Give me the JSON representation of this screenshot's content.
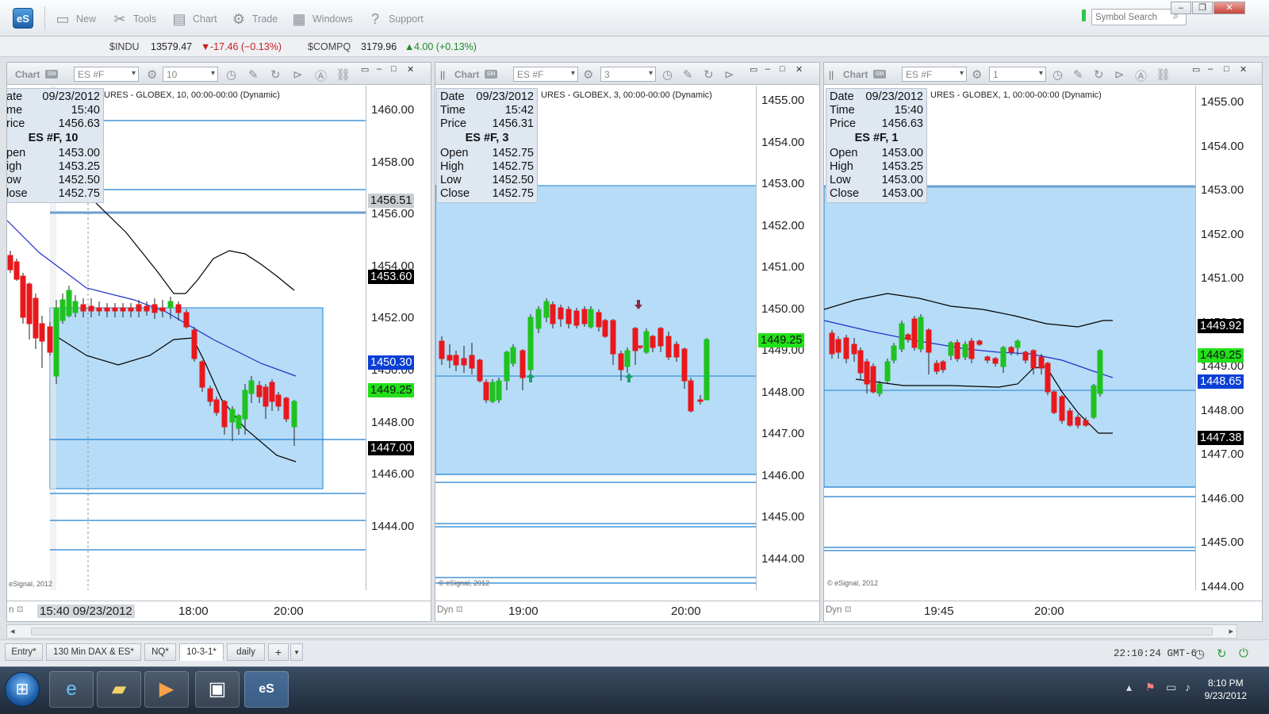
{
  "app": {
    "logo": "eS"
  },
  "toolbar": {
    "items": [
      {
        "label": "New",
        "icon": "new-window-icon"
      },
      {
        "label": "Tools",
        "icon": "tools-icon"
      },
      {
        "label": "Chart",
        "icon": "chart-icon"
      },
      {
        "label": "Trade",
        "icon": "trade-icon"
      },
      {
        "label": "Windows",
        "icon": "windows-icon"
      },
      {
        "label": "Support",
        "icon": "support-icon"
      }
    ],
    "search_placeholder": "Symbol Search"
  },
  "ticker": [
    {
      "symbol": "$INDU",
      "last": "13579.47",
      "change": "-17.46 (−0.13%)",
      "dir": "down"
    },
    {
      "symbol": "$COMPQ",
      "last": "3179.96",
      "change": "4.00 (+0.13%)",
      "dir": "up"
    }
  ],
  "charts": [
    {
      "title": "Chart",
      "symbol": "ES #F",
      "interval": "10",
      "description": "URES - GLOBEX, 10, 00:00-00:00 (Dynamic)",
      "info": {
        "date_label": "ate",
        "date": "09/23/2012",
        "time_label": "me",
        "time": "15:40",
        "price_label": "rice",
        "price": "1456.63",
        "heading": "ES #F, 10",
        "open_label": "pen",
        "open": "1453.00",
        "high_label": "igh",
        "high": "1453.25",
        "low_label": "ow",
        "low": "1452.50",
        "close_label": "lose",
        "close": "1452.75"
      },
      "y_ticks": [
        "1460.00",
        "1458.00",
        "1456.00",
        "1454.00",
        "1452.00",
        "1450.00",
        "1448.00",
        "1446.00",
        "1444.00"
      ],
      "y_tags": [
        {
          "value": "1456.51",
          "bg": "#c8cdd2",
          "fg": "#111"
        },
        {
          "value": "1453.60",
          "bg": "#000000",
          "fg": "#ffffff"
        },
        {
          "value": "1450.30",
          "bg": "#0a3fd6",
          "fg": "#ffffff"
        },
        {
          "value": "1449.25",
          "bg": "#22e01a",
          "fg": "#111"
        },
        {
          "value": "1447.00",
          "bg": "#000000",
          "fg": "#ffffff"
        }
      ],
      "x_ticks": [
        "18:00",
        "20:00"
      ],
      "cursor_label": "15:40 09/23/2012",
      "footer_left": "n",
      "copyright": "eSignal, 2012"
    },
    {
      "title": "Chart",
      "symbol": "ES #F",
      "interval": "3",
      "description": "URES - GLOBEX, 3, 00:00-00:00 (Dynamic)",
      "info": {
        "date_label": "Date",
        "date": "09/23/2012",
        "time_label": "Time",
        "time": "15:42",
        "price_label": "Price",
        "price": "1456.31",
        "heading": "ES #F, 3",
        "open_label": "Open",
        "open": "1452.75",
        "high_label": "High",
        "high": "1452.75",
        "low_label": "Low",
        "low": "1452.50",
        "close_label": "Close",
        "close": "1452.75"
      },
      "y_ticks": [
        "1455.00",
        "1454.00",
        "1453.00",
        "1452.00",
        "1451.00",
        "1450.00",
        "1449.00",
        "1448.00",
        "1447.00",
        "1446.00",
        "1445.00",
        "1444.00"
      ],
      "y_tags": [
        {
          "value": "1449.25",
          "bg": "#22e01a",
          "fg": "#111"
        }
      ],
      "x_ticks": [
        "19:00",
        "20:00"
      ],
      "footer_left": "Dyn",
      "copyright": "© eSignal, 2012"
    },
    {
      "title": "Chart",
      "symbol": "ES #F",
      "interval": "1",
      "description": "URES - GLOBEX, 1, 00:00-00:00 (Dynamic)",
      "info": {
        "date_label": "Date",
        "date": "09/23/2012",
        "time_label": "Time",
        "time": "15:40",
        "price_label": "Price",
        "price": "1456.63",
        "heading": "ES #F, 1",
        "open_label": "Open",
        "open": "1453.00",
        "high_label": "High",
        "high": "1453.25",
        "low_label": "Low",
        "low": "1453.00",
        "close_label": "Close",
        "close": "1453.00"
      },
      "y_ticks": [
        "1455.00",
        "1454.00",
        "1453.00",
        "1452.00",
        "1451.00",
        "1450.00",
        "1449.00",
        "1448.00",
        "1447.00",
        "1446.00",
        "1445.00",
        "1444.00"
      ],
      "y_tags": [
        {
          "value": "1449.92",
          "bg": "#000000",
          "fg": "#ffffff"
        },
        {
          "value": "1449.25",
          "bg": "#22e01a",
          "fg": "#111"
        },
        {
          "value": "1448.65",
          "bg": "#0a3fd6",
          "fg": "#ffffff"
        },
        {
          "value": "1447.38",
          "bg": "#000000",
          "fg": "#ffffff"
        }
      ],
      "x_ticks": [
        "19:45",
        "20:00"
      ],
      "footer_left": "Dyn",
      "copyright": "© eSignal, 2012"
    }
  ],
  "tabs": [
    {
      "label": "Entry*"
    },
    {
      "label": "130 Min DAX & ES*"
    },
    {
      "label": "NQ*"
    },
    {
      "label": "10-3-1*",
      "active": true
    },
    {
      "label": "daily"
    }
  ],
  "status": {
    "clock": "22:10:24 GMT-6"
  },
  "taskbar": {
    "time": "8:10 PM",
    "date": "9/23/2012"
  },
  "colors": {
    "zone": "#b6dcf7",
    "bull": "#1fc21f",
    "bear": "#e8181c",
    "ma": "#2030c8",
    "band": "#000000",
    "level": "#1d7fd0"
  }
}
